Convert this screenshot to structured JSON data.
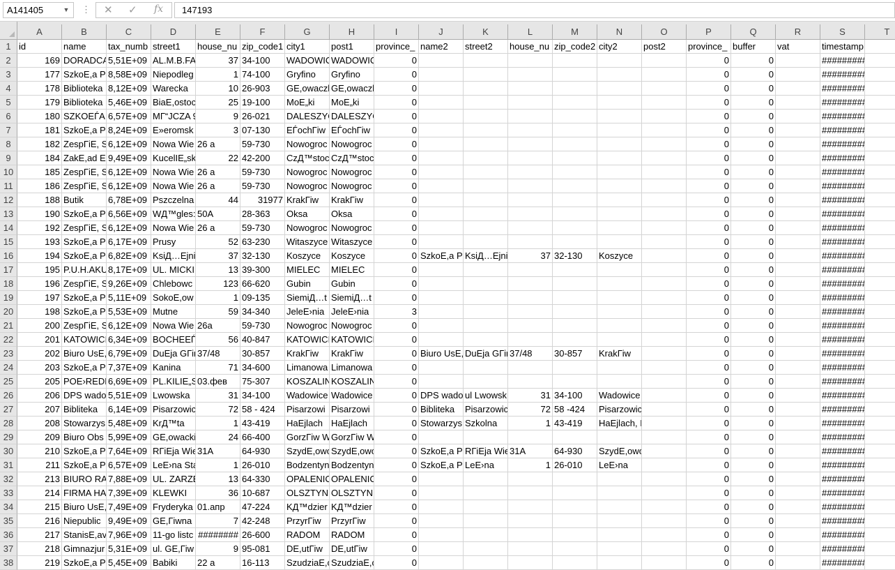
{
  "name_box": "A141405",
  "formula_bar": {
    "cancel_icon": "close-icon",
    "enter_icon": "check-icon",
    "fx_label": "fx",
    "value": "147193"
  },
  "columns": [
    "A",
    "B",
    "C",
    "D",
    "E",
    "F",
    "G",
    "H",
    "I",
    "J",
    "K",
    "L",
    "M",
    "N",
    "O",
    "P",
    "Q",
    "R",
    "S",
    "T"
  ],
  "rows": [
    {
      "n": "1",
      "cells": [
        "id",
        "name",
        "tax_numb",
        "street1",
        "house_nu",
        "zip_code1",
        "city1",
        "post1",
        "province_",
        "name2",
        "street2",
        "house_nu",
        "zip_code2",
        "city2",
        "post2",
        "province_",
        "buffer",
        "vat",
        "timestamp",
        ""
      ]
    },
    {
      "n": "2",
      "cells": [
        "169",
        "DORADCA",
        "5,51E+09",
        "AL.M.B.FA",
        "37",
        "34-100",
        "WADOWIC",
        "WADOWIC",
        "0",
        "",
        "",
        "",
        "",
        "",
        "",
        "0",
        "0",
        "",
        "#########",
        ""
      ]
    },
    {
      "n": "3",
      "cells": [
        "177",
        "SzkoE,a Pc",
        "8,58E+09",
        "Niepodleg",
        "1",
        "74-100",
        "Gryfino",
        "Gryfino",
        "0",
        "",
        "",
        "",
        "",
        "",
        "",
        "0",
        "0",
        "",
        "#########",
        ""
      ]
    },
    {
      "n": "4",
      "cells": [
        "178",
        "Biblioteka",
        "8,12E+09",
        "Warecka",
        "10",
        "26-903",
        "GE,owaczl",
        "GE,owaczl",
        "0",
        "",
        "",
        "",
        "",
        "",
        "",
        "0",
        "0",
        "",
        "#########",
        ""
      ]
    },
    {
      "n": "5",
      "cells": [
        "179",
        "Biblioteka",
        "5,46E+09",
        "BiaE,ostoc",
        "25",
        "19-100",
        "MoE„ki",
        "MoE„ki",
        "0",
        "",
        "",
        "",
        "",
        "",
        "",
        "0",
        "0",
        "",
        "#########",
        ""
      ]
    },
    {
      "n": "6",
      "cells": [
        "180",
        "SZKOEЃA F",
        "6,57E+09",
        "MГ“JCZA 9",
        "9",
        "26-021",
        "DALESZYC",
        "DALESZYC",
        "0",
        "",
        "",
        "",
        "",
        "",
        "",
        "0",
        "0",
        "",
        "#########",
        ""
      ]
    },
    {
      "n": "7",
      "cells": [
        "181",
        "SzkoE,a Pc",
        "8,24E+09",
        "E»eromsk",
        "3",
        "07-130",
        "EЃochГіw",
        "EЃochГіw",
        "0",
        "",
        "",
        "",
        "",
        "",
        "",
        "0",
        "0",
        "",
        "#########",
        ""
      ]
    },
    {
      "n": "8",
      "cells": [
        "182",
        "ZespГіE, S",
        "6,12E+09",
        "Nowa Wie",
        "26 a",
        "59-730",
        "Nowogroc",
        "Nowogroc",
        "0",
        "",
        "",
        "",
        "",
        "",
        "",
        "0",
        "0",
        "",
        "#########",
        ""
      ]
    },
    {
      "n": "9",
      "cells": [
        "184",
        "ZakE,ad El",
        "9,49E+09",
        "KucelIE„sk",
        "22",
        "42-200",
        "CzД™stoc",
        "CzД™stoc",
        "0",
        "",
        "",
        "",
        "",
        "",
        "",
        "0",
        "0",
        "",
        "#########",
        ""
      ]
    },
    {
      "n": "10",
      "cells": [
        "185",
        "ZespГіE, S",
        "6,12E+09",
        "Nowa Wie",
        "26 a",
        "59-730",
        "Nowogroc",
        "Nowogroc",
        "0",
        "",
        "",
        "",
        "",
        "",
        "",
        "0",
        "0",
        "",
        "#########",
        ""
      ]
    },
    {
      "n": "11",
      "cells": [
        "186",
        "ZespГіE, S",
        "6,12E+09",
        "Nowa Wie",
        "26 a",
        "59-730",
        "Nowogroc",
        "Nowogroc",
        "0",
        "",
        "",
        "",
        "",
        "",
        "",
        "0",
        "0",
        "",
        "#########",
        ""
      ]
    },
    {
      "n": "12",
      "cells": [
        "188",
        "Butik",
        "6,78E+09",
        "Pszczelna",
        "44",
        "31977",
        "KrakГіw",
        "KrakГіw",
        "0",
        "",
        "",
        "",
        "",
        "",
        "",
        "0",
        "0",
        "",
        "#########",
        ""
      ]
    },
    {
      "n": "13",
      "cells": [
        "190",
        "SzkoE,a Pc",
        "6,56E+09",
        "WД™gles:",
        "50A",
        "28-363",
        "Oksa",
        "Oksa",
        "0",
        "",
        "",
        "",
        "",
        "",
        "",
        "0",
        "0",
        "",
        "#########",
        ""
      ]
    },
    {
      "n": "14",
      "cells": [
        "192",
        "ZespГіE, S",
        "6,12E+09",
        "Nowa Wie",
        "26 a",
        "59-730",
        "Nowogroc",
        "Nowogroc",
        "0",
        "",
        "",
        "",
        "",
        "",
        "",
        "0",
        "0",
        "",
        "#########",
        ""
      ]
    },
    {
      "n": "15",
      "cells": [
        "193",
        "SzkoE,a Pc",
        "6,17E+09",
        "Prusy",
        "52",
        "63-230",
        "Witaszyce",
        "Witaszyce",
        "0",
        "",
        "",
        "",
        "",
        "",
        "",
        "0",
        "0",
        "",
        "#########",
        ""
      ]
    },
    {
      "n": "16",
      "cells": [
        "194",
        "SzkoE,a Pc",
        "6,82E+09",
        "KsiД…Ejni",
        "37",
        "32-130",
        "Koszyce",
        "Koszyce",
        "0",
        "SzkoE,a Pc",
        "KsiД…Ejni",
        "37",
        "32-130",
        "Koszyce",
        "",
        "0",
        "0",
        "",
        "#########",
        ""
      ]
    },
    {
      "n": "17",
      "cells": [
        "195",
        "P.U.H.AKU",
        "8,17E+09",
        "UL. MICKIE",
        "13",
        "39-300",
        "MIELEC",
        "MIELEC",
        "0",
        "",
        "",
        "",
        "",
        "",
        "",
        "0",
        "0",
        "",
        "#########",
        ""
      ]
    },
    {
      "n": "18",
      "cells": [
        "196",
        "ZespГіE, S",
        "9,26E+09",
        "Chlebowc",
        "123",
        "66-620",
        "Gubin",
        "Gubin",
        "0",
        "",
        "",
        "",
        "",
        "",
        "",
        "0",
        "0",
        "",
        "#########",
        ""
      ]
    },
    {
      "n": "19",
      "cells": [
        "197",
        "SzkoE,a Pc",
        "5,11E+09",
        "SokoE,ow",
        "1",
        "09-135",
        "SiemiД…t",
        "SiemiД…t",
        "0",
        "",
        "",
        "",
        "",
        "",
        "",
        "0",
        "0",
        "",
        "#########",
        ""
      ]
    },
    {
      "n": "20",
      "cells": [
        "198",
        "SzkoE,a Pc",
        "5,53E+09",
        "Mutne",
        "59",
        "34-340",
        "JeleE›nia",
        "JeleE›nia",
        "3",
        "",
        "",
        "",
        "",
        "",
        "",
        "0",
        "0",
        "",
        "#########",
        ""
      ]
    },
    {
      "n": "21",
      "cells": [
        "200",
        "ZespГіE, S",
        "6,12E+09",
        "Nowa Wie",
        "26a",
        "59-730",
        "Nowogroc",
        "Nowogroc",
        "0",
        "",
        "",
        "",
        "",
        "",
        "",
        "0",
        "0",
        "",
        "#########",
        ""
      ]
    },
    {
      "n": "22",
      "cells": [
        "201",
        "KATOWICI",
        "6,34E+09",
        "BOCHEEЃS",
        "56",
        "40-847",
        "KATOWICI",
        "KATOWICI",
        "0",
        "",
        "",
        "",
        "",
        "",
        "",
        "0",
        "0",
        "",
        "#########",
        ""
      ]
    },
    {
      "n": "23",
      "cells": [
        "202",
        "Biuro UsE,",
        "6,79E+09",
        "DuEja GГіr",
        "37/48",
        "30-857",
        "KrakГіw",
        "KrakГіw",
        "0",
        "Biuro UsE,",
        "DuEja GГіr",
        "37/48",
        "30-857",
        "KrakГіw",
        "",
        "0",
        "0",
        "",
        "#########",
        ""
      ]
    },
    {
      "n": "24",
      "cells": [
        "203",
        "SzkoE,a Pc",
        "7,37E+09",
        "Kanina",
        "71",
        "34-600",
        "Limanowa",
        "Limanowa",
        "0",
        "",
        "",
        "",
        "",
        "",
        "",
        "0",
        "0",
        "",
        "#########",
        ""
      ]
    },
    {
      "n": "25",
      "cells": [
        "205",
        "POE›REDN",
        "6,69E+09",
        "PL.KILIE„S",
        "03.фев",
        "75-307",
        "KOSZALIN",
        "KOSZALIN",
        "0",
        "",
        "",
        "",
        "",
        "",
        "",
        "0",
        "0",
        "",
        "#########",
        ""
      ]
    },
    {
      "n": "26",
      "cells": [
        "206",
        "DPS wado",
        "5,51E+09",
        "Lwowska",
        "31",
        "34-100",
        "Wadowice",
        "Wadowice",
        "0",
        "DPS wado",
        "ul Lwowsk",
        "31",
        "34-100",
        "Wadowice",
        "",
        "0",
        "0",
        "",
        "#########",
        ""
      ]
    },
    {
      "n": "27",
      "cells": [
        "207",
        "Bibliteka",
        "6,14E+09",
        "Pisarzowic",
        "72",
        "58 - 424",
        "Pisarzowi",
        "Pisarzowi",
        "0",
        "Bibliteka",
        "Pisarzowic",
        "72",
        "58 -424",
        "Pisarzowice",
        "",
        "0",
        "0",
        "",
        "#########",
        ""
      ]
    },
    {
      "n": "28",
      "cells": [
        "208",
        "Stowarzys",
        "5,48E+09",
        "KrД™ta",
        "1",
        "43-419",
        "HaEjlach",
        "HaEjlach",
        "0",
        "Stowarzys",
        "Szkolna",
        "1",
        "43-419",
        "HaEjlach, Rudnik",
        "",
        "0",
        "0",
        "",
        "#########",
        ""
      ]
    },
    {
      "n": "29",
      "cells": [
        "209",
        "Biuro Obs",
        "5,99E+09",
        "GE,owacki",
        "24",
        "66-400",
        "GorzГіw W",
        "GorzГіw W",
        "0",
        "",
        "",
        "",
        "",
        "",
        "",
        "0",
        "0",
        "",
        "#########",
        ""
      ]
    },
    {
      "n": "30",
      "cells": [
        "210",
        "SzkoE,a Pc",
        "7,64E+09",
        "RГіEja Wie",
        "31A",
        "64-930",
        "SzydE,owo",
        "SzydE,owo",
        "0",
        "SzkoE,a Pc",
        "RГіEja Wie",
        "31A",
        "64-930",
        "SzydE,owo",
        "",
        "0",
        "0",
        "",
        "#########",
        ""
      ]
    },
    {
      "n": "31",
      "cells": [
        "211",
        "SzkoE,a Pc",
        "6,57E+09",
        "LeE›na Sta",
        "1",
        "26-010",
        "Bodzentyn",
        "Bodzentyn",
        "0",
        "SzkoE,a Pc",
        "LeE›na",
        "1",
        "26-010",
        "LeE›na",
        "",
        "0",
        "0",
        "",
        "#########",
        ""
      ]
    },
    {
      "n": "32",
      "cells": [
        "213",
        "BIURO RA",
        "7,88E+09",
        "UL. ZARZE",
        "13",
        "64-330",
        "OPALENIC",
        "OPALENIC",
        "0",
        "",
        "",
        "",
        "",
        "",
        "",
        "0",
        "0",
        "",
        "#########",
        ""
      ]
    },
    {
      "n": "33",
      "cells": [
        "214",
        "FIRMA HA",
        "7,39E+09",
        "KLEWKI",
        "36",
        "10-687",
        "OLSZTYN",
        "OLSZTYN",
        "0",
        "",
        "",
        "",
        "",
        "",
        "",
        "0",
        "0",
        "",
        "#########",
        ""
      ]
    },
    {
      "n": "34",
      "cells": [
        "215",
        "Biuro UsE,",
        "7,49E+09",
        "Fryderyka",
        "01.апр",
        "47-224",
        "KД™dzier",
        "KД™dzier",
        "0",
        "",
        "",
        "",
        "",
        "",
        "",
        "0",
        "0",
        "",
        "#########",
        ""
      ]
    },
    {
      "n": "35",
      "cells": [
        "216",
        "Niepublic",
        "9,49E+09",
        "GE,Гіwna",
        "7",
        "42-248",
        "PrzyrГіw",
        "PrzyrГіw",
        "0",
        "",
        "",
        "",
        "",
        "",
        "",
        "0",
        "0",
        "",
        "#########",
        ""
      ]
    },
    {
      "n": "36",
      "cells": [
        "217",
        "StanisE,av",
        "7,96E+09",
        "11-go listc",
        "########",
        "26-600",
        "RADOM",
        "RADOM",
        "0",
        "",
        "",
        "",
        "",
        "",
        "",
        "0",
        "0",
        "",
        "#########",
        ""
      ]
    },
    {
      "n": "37",
      "cells": [
        "218",
        "Gimnazjur",
        "5,31E+09",
        "ul. GE,Гіw",
        "9",
        "95-081",
        "DE,utГіw",
        "DE,utГіw",
        "0",
        "",
        "",
        "",
        "",
        "",
        "",
        "0",
        "0",
        "",
        "#########",
        ""
      ]
    },
    {
      "n": "38",
      "cells": [
        "219",
        "SzkoE,a Pc",
        "5,45E+09",
        "Babiki",
        "22 a",
        "16-113",
        "SzudziaE,c",
        "SzudziaE,c",
        "0",
        "",
        "",
        "",
        "",
        "",
        "",
        "0",
        "0",
        "",
        "#########",
        ""
      ]
    }
  ]
}
